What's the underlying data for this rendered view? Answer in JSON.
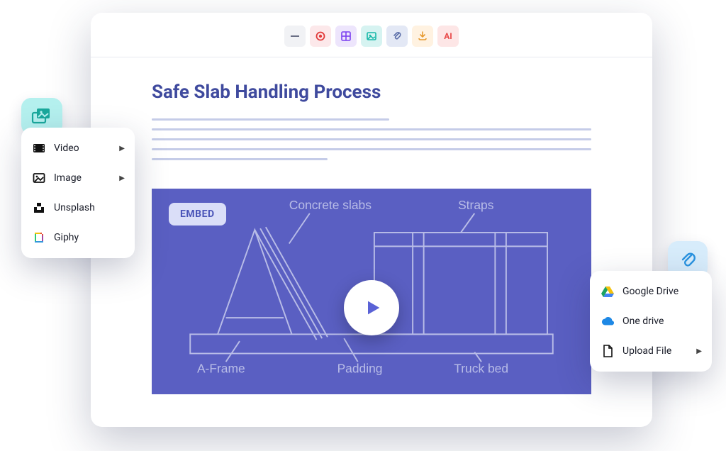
{
  "toolbar": {
    "ai_label": "AI"
  },
  "document": {
    "title": "Safe Slab Handling Process"
  },
  "embed": {
    "badge": "EMBED",
    "diagram_labels": {
      "concrete_slabs": "Concrete slabs",
      "straps": "Straps",
      "a_frame": "A-Frame",
      "padding": "Padding",
      "truck_bed": "Truck bed"
    }
  },
  "media_menu": {
    "items": [
      {
        "label": "Video",
        "has_submenu": true
      },
      {
        "label": "Image",
        "has_submenu": true
      },
      {
        "label": "Unsplash",
        "has_submenu": false
      },
      {
        "label": "Giphy",
        "has_submenu": false
      }
    ]
  },
  "attach_menu": {
    "items": [
      {
        "label": "Google Drive",
        "has_submenu": false
      },
      {
        "label": "One drive",
        "has_submenu": false
      },
      {
        "label": "Upload File",
        "has_submenu": true
      }
    ]
  }
}
